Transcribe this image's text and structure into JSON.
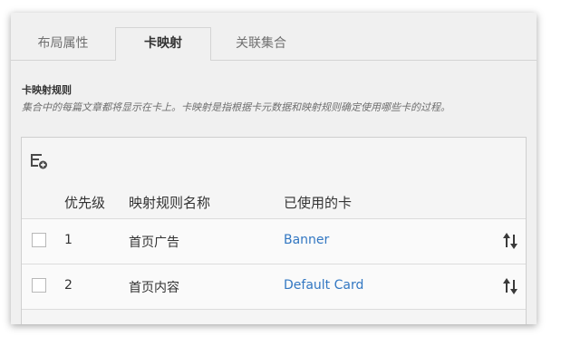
{
  "tabs": [
    {
      "label": "布局属性"
    },
    {
      "label": "卡映射"
    },
    {
      "label": "关联集合"
    }
  ],
  "section": {
    "title": "卡映射规则",
    "description": "集合中的每篇文章都将显示在卡上。卡映射是指根据卡元数据和映射规则确定使用哪些卡的过程。"
  },
  "grid": {
    "columns": {
      "priority": "优先级",
      "name": "映射规则名称",
      "card": "已使用的卡"
    },
    "rows": [
      {
        "priority": "1",
        "name": "首页广告",
        "card": "Banner",
        "checked": false
      },
      {
        "priority": "2",
        "name": "首页内容",
        "card": "Default Card",
        "checked": false
      }
    ]
  },
  "icons": {
    "toolbar": "add-rule-icon",
    "row_action": "reorder-icon"
  },
  "colors": {
    "link": "#3277c2",
    "active_tab_text": "#333333"
  }
}
